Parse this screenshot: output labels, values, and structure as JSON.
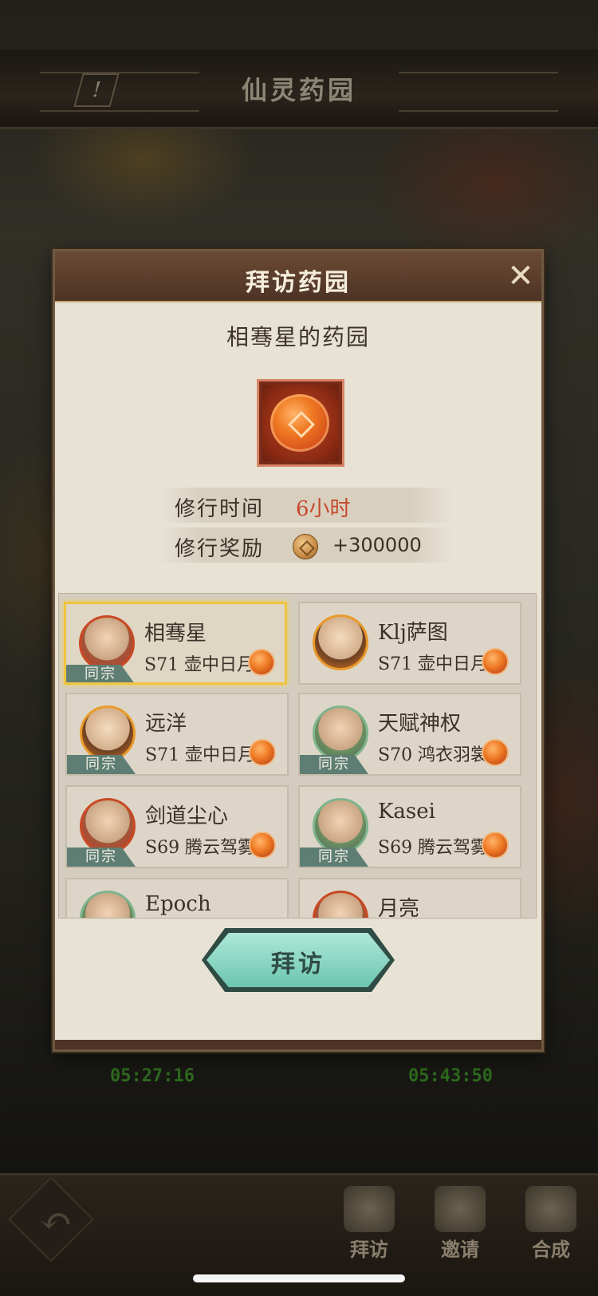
{
  "app": {
    "title": "仙灵药园"
  },
  "dialog": {
    "title": "拜访药园",
    "garden_name": "相骞星的药园",
    "info": {
      "time_label": "修行时间",
      "time_value": "6小时",
      "reward_label": "修行奖励",
      "reward_value": "+300000"
    },
    "friends": [
      {
        "name": "相骞星",
        "server": "S71 壶中日月",
        "badge": "同宗",
        "selected": true
      },
      {
        "name": "Klj萨图",
        "server": "S71 壶中日月",
        "badge": "",
        "selected": false
      },
      {
        "name": "远洋",
        "server": "S71 壶中日月",
        "badge": "同宗",
        "selected": false
      },
      {
        "name": "天赋神权",
        "server": "S70 鸿衣羽裳",
        "badge": "同宗",
        "selected": false
      },
      {
        "name": "剑道尘心",
        "server": "S69 腾云驾雾",
        "badge": "同宗",
        "selected": false
      },
      {
        "name": "Kasei",
        "server": "S69 腾云驾雾",
        "badge": "同宗",
        "selected": false
      },
      {
        "name": "Epoch",
        "server": "",
        "badge": "",
        "selected": false
      },
      {
        "name": "月亮",
        "server": "",
        "badge": "",
        "selected": false
      }
    ],
    "visit_label": "拜访"
  },
  "timers": [
    "05:27:16",
    "05:43:50"
  ],
  "bottom_nav": [
    {
      "label": "拜访",
      "icon": "visit-icon"
    },
    {
      "label": "邀请",
      "icon": "invite-scroll-icon"
    },
    {
      "label": "合成",
      "icon": "synthesize-icon"
    }
  ],
  "icons": {
    "close": "close-icon",
    "info": "info-icon",
    "back": "back-arrow-icon",
    "currency": "coin-icon"
  },
  "colors": {
    "accent_time": "#c5482a",
    "selected_border": "#f0c440",
    "visit_button": "#6cc6b0"
  }
}
